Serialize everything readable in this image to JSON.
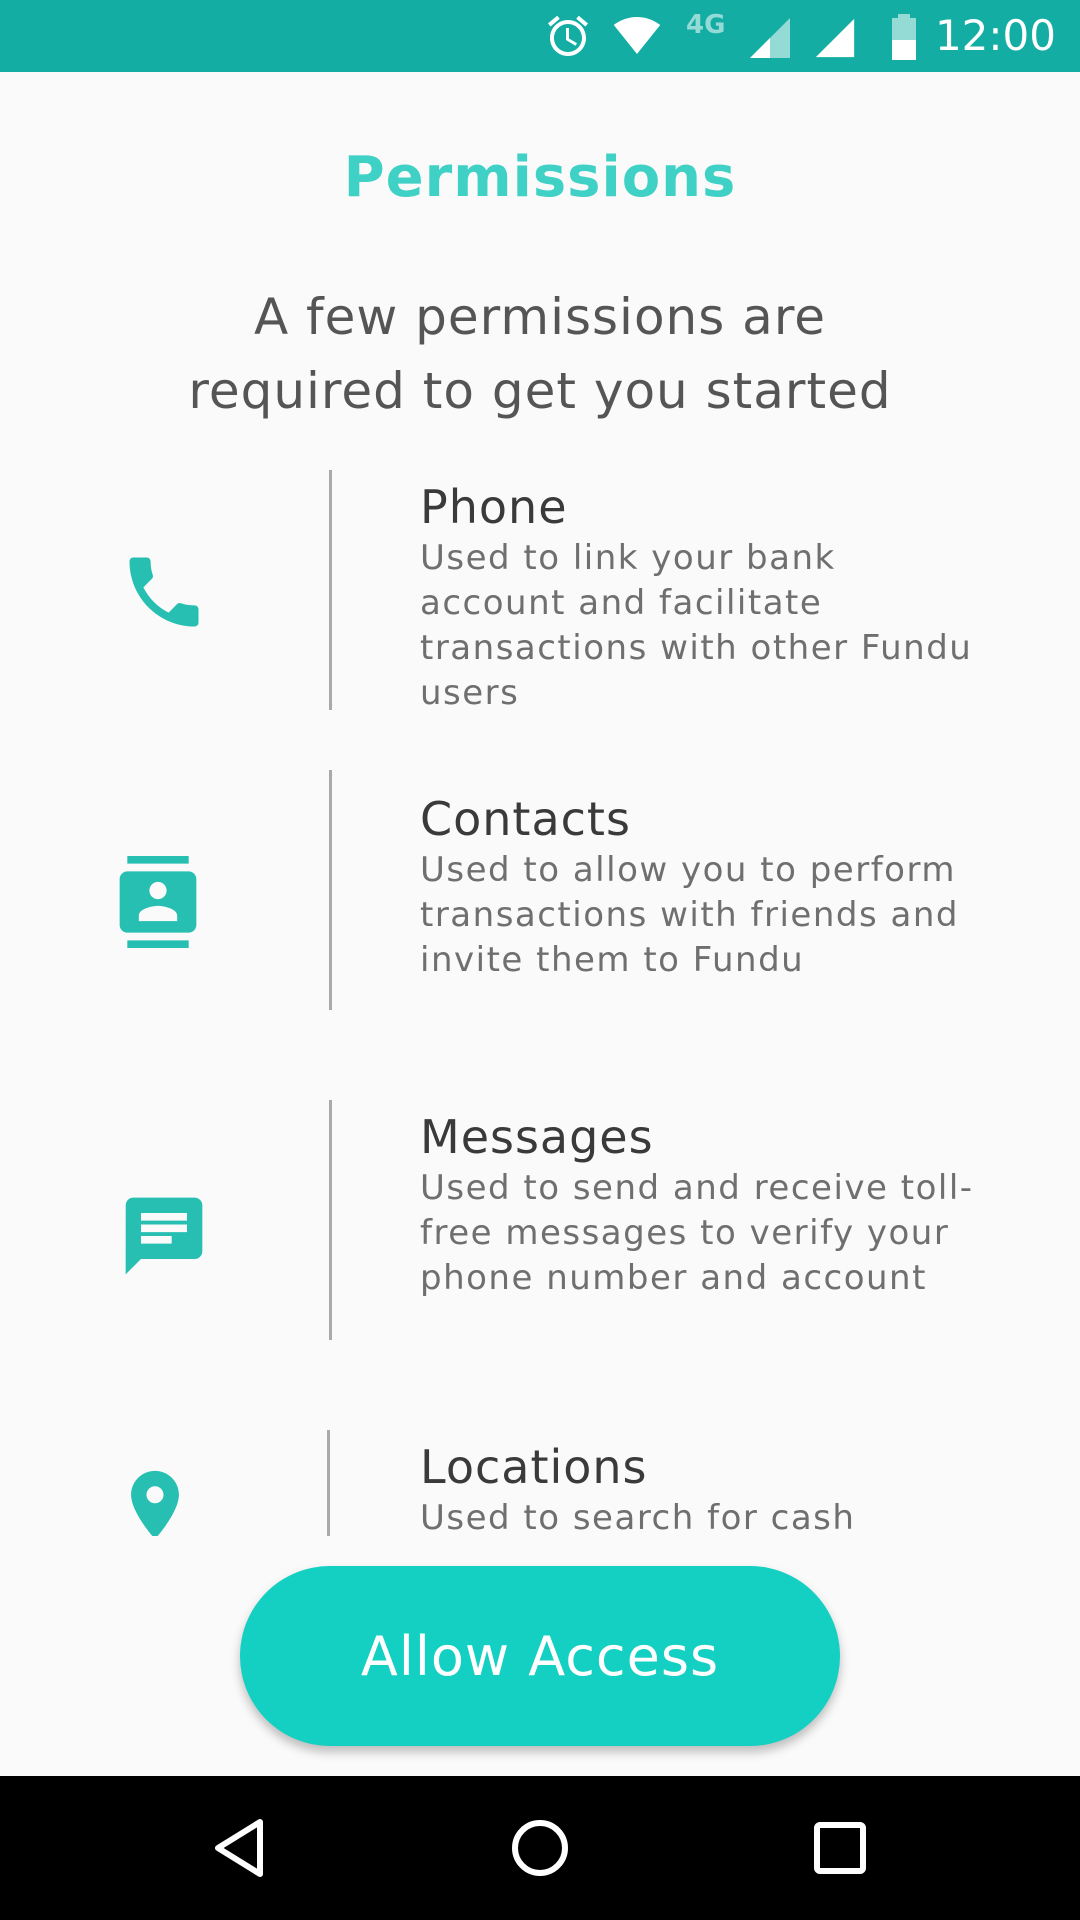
{
  "status_bar": {
    "network_label": "4G",
    "time": "12:00",
    "icons": [
      "alarm-icon",
      "wifi-icon",
      "signal-icon",
      "battery-icon"
    ],
    "background_color": "#13ada3"
  },
  "header": {
    "title": "Permissions",
    "subtitle_line1": "A few permissions are",
    "subtitle_line2": "required to get you started"
  },
  "permissions": [
    {
      "icon": "phone-icon",
      "title": "Phone",
      "description": "Used to link your bank account and facilitate transactions with other Fundu users"
    },
    {
      "icon": "contacts-icon",
      "title": "Contacts",
      "description": "Used to allow you to perform transactions with friends and invite them to Fundu"
    },
    {
      "icon": "message-icon",
      "title": "Messages",
      "description": "Used to send and receive toll-free messages to verify your phone number and account"
    },
    {
      "icon": "location-icon",
      "title": "Locations",
      "description": "Used to search for cash"
    }
  ],
  "actions": {
    "allow_label": "Allow Access"
  },
  "nav_bar": {
    "icons": [
      "back-icon",
      "home-icon",
      "recents-icon"
    ]
  },
  "colors": {
    "accent": "#14d0c3",
    "title": "#3fd1c5",
    "icon": "#26bfb2"
  }
}
